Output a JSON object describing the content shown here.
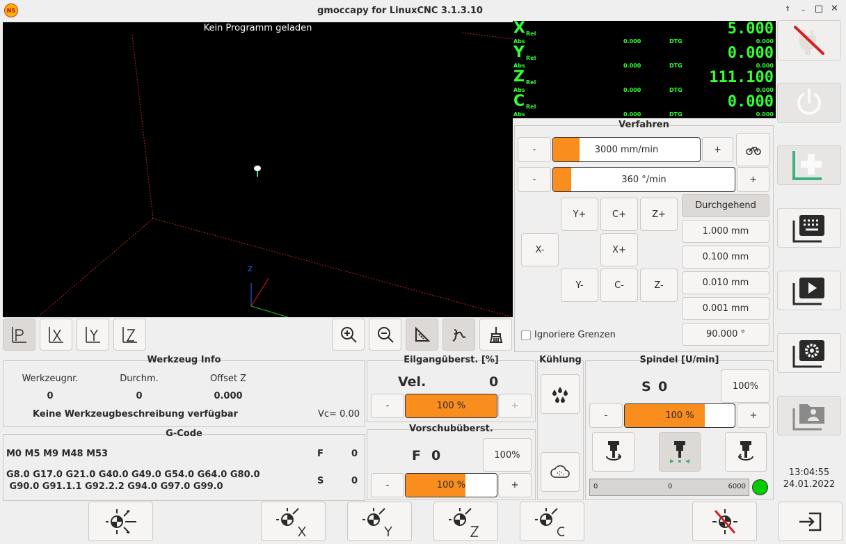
{
  "window": {
    "title": "gmoccapy for LinuxCNC  3.1.3.10",
    "logo_text": "NS"
  },
  "preview": {
    "status": "Kein Programm geladen",
    "axis_label": "Z"
  },
  "dro": {
    "axes": [
      {
        "name": "X",
        "rel": "Rel",
        "abs": "Abs",
        "value": "5.000",
        "abs_value": "0.000",
        "dtg": "DTG",
        "dtg_value": "0.000"
      },
      {
        "name": "Y",
        "rel": "Rel",
        "abs": "Abs",
        "value": "0.000",
        "abs_value": "0.000",
        "dtg": "DTG",
        "dtg_value": "0.000"
      },
      {
        "name": "Z",
        "rel": "Rel",
        "abs": "Abs",
        "value": "111.100",
        "abs_value": "0.000",
        "dtg": "DTG",
        "dtg_value": "0.000"
      },
      {
        "name": "C",
        "rel": "Rel",
        "abs": "Abs",
        "value": "0.000",
        "abs_value": "0.000",
        "dtg": "DTG",
        "dtg_value": "0.000"
      }
    ]
  },
  "jog": {
    "title": "Verfahren",
    "linear_speed": "3000 mm/min",
    "linear_fill": 0.18,
    "angular_speed": "360 °/min",
    "angular_fill": 0.1,
    "minus": "-",
    "plus": "+",
    "buttons": {
      "yplus": "Y+",
      "cplus": "C+",
      "zplus": "Z+",
      "xminus": "X-",
      "xplus": "X+",
      "yminus": "Y-",
      "cminus": "C-",
      "zminus": "Z-"
    },
    "increments": [
      "Durchgehend",
      "1.000 mm",
      "0.100 mm",
      "0.010 mm",
      "0.001 mm",
      "90.000 °"
    ],
    "ignore_limits": "Ignoriere Grenzen"
  },
  "tool": {
    "title": "Werkzeug Info",
    "headers": [
      "Werkzeugnr.",
      "Durchm.",
      "Offset Z"
    ],
    "values": [
      "0",
      "0",
      "0.000"
    ],
    "description": "Keine Werkzeugbeschreibung verfügbar",
    "vc": "Vc= 0.00"
  },
  "rapid": {
    "title": "Eilgangüberst. [%]",
    "vel_label": "Vel.",
    "vel_value": "0",
    "percent": "100 %",
    "fill": 1.0,
    "minus": "-",
    "plus": "+"
  },
  "feed": {
    "title": "Vorschubüberst.",
    "f_label": "F",
    "f_value": "0",
    "reset": "100%",
    "percent": "100 %",
    "fill": 0.66,
    "minus": "-",
    "plus": "+"
  },
  "coolant": {
    "title": "Kühlung"
  },
  "spindle": {
    "title": "Spindel [U/min]",
    "s_label": "S",
    "s_value": "0",
    "reset": "100%",
    "percent": "100 %",
    "fill": 0.73,
    "minus": "-",
    "plus": "+",
    "scale_min": "0",
    "scale_mid": "0",
    "scale_max": "6000",
    "status_color": "#00cc00"
  },
  "gcode": {
    "title": "G-Code",
    "mcodes": "M0 M5 M9 M48 M53",
    "f_label": "F",
    "f_value": "0",
    "gcodes_line1": "G8.0 G17.0 G21.0 G40.0 G49.0 G54.0 G64.0 G80.0",
    "gcodes_line2": " G90.0 G91.1.1 G92.2.2 G94.0 G97.0 G99.0",
    "s_label": "S",
    "s_value": "0"
  },
  "clock": {
    "time": "13:04:55",
    "date": "24.01.2022"
  },
  "colors": {
    "accent": "#f98d1d",
    "dro_text": "#33ff33",
    "teal": "#3bb17d"
  }
}
